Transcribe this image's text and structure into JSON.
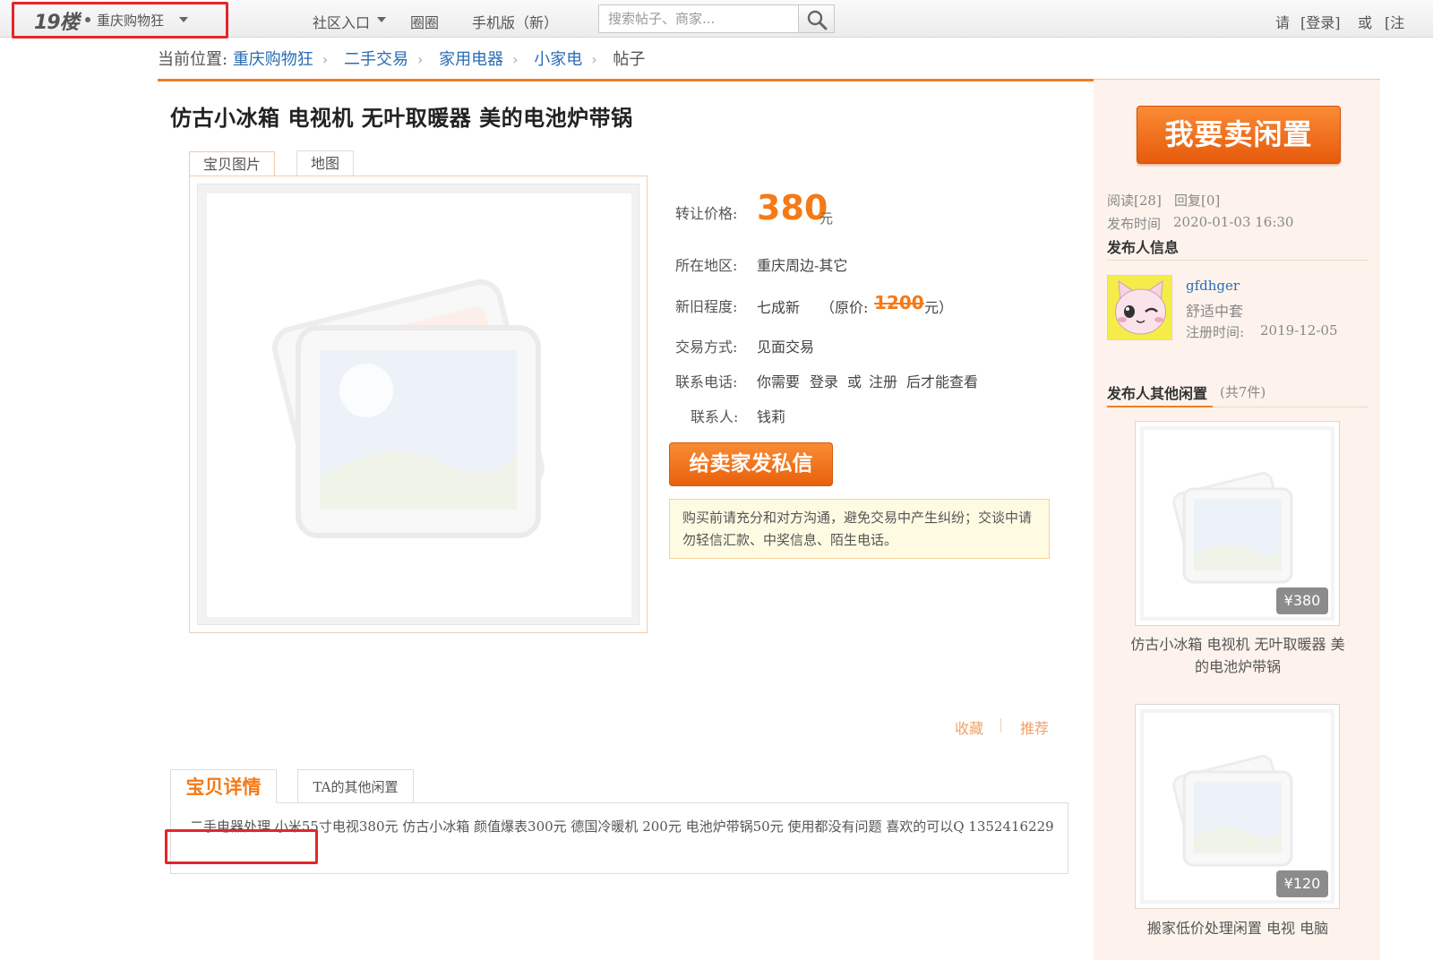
{
  "topbar": {
    "logo": "19楼",
    "community": "重庆购物狂",
    "nav": [
      "社区入口",
      "圈圈",
      "手机版（新）"
    ],
    "search_placeholder": "搜索帖子、商家...",
    "login_prefix": "请",
    "login": "[登录]",
    "or": "或",
    "register": "[注"
  },
  "breadcrumb": {
    "label": "当前位置:",
    "items": [
      "重庆购物狂",
      "二手交易",
      "家用电器",
      "小家电"
    ],
    "current": "帖子"
  },
  "post": {
    "title": "仿古小冰箱 电视机 无叶取暖器 美的电池炉带锅",
    "image_tabs": [
      "宝贝图片",
      "地图"
    ],
    "price_label": "转让价格:",
    "price": "380",
    "price_unit": "元",
    "region_label": "所在地区:",
    "region": "重庆周边-其它",
    "condition_label": "新旧程度:",
    "condition": "七成新",
    "orig_price_prefix": "（原价:",
    "orig_price": "1200",
    "orig_price_suffix": "元）",
    "trade_label": "交易方式:",
    "trade": "见面交易",
    "phone_label": "联系电话:",
    "phone_parts": [
      "你需要",
      "登录",
      "或",
      "注册",
      "后才能查看"
    ],
    "contact_label": "联系人:",
    "contact": "钱莉",
    "message_button": "给卖家发私信",
    "tip": "购买前请充分和对方沟通，避免交易中产生纠纷；交谈中请勿轻信汇款、中奖信息、陌生电话。",
    "favorite": "收藏",
    "recommend": "推荐"
  },
  "details": {
    "tab_active": "宝贝详情",
    "tab_other": "TA的其他闲置",
    "text": "二手电器处理 小米55寸电视380元 仿古小冰箱 颜值爆表300元 德国冷暖机 200元 电池炉带锅50元 使用都没有问题 喜欢的可以Q 1352416229"
  },
  "sidebar": {
    "sell_button": "我要卖闲置",
    "reads": "阅读[28]",
    "replies": "回复[0]",
    "posted_label": "发布时间",
    "posted_time": "2020-01-03 16:30",
    "publisher_heading": "发布人信息",
    "username": "gfdhger",
    "user_level": "舒适中套",
    "register_label": "注册时间:",
    "register_date": "2019-12-05",
    "other_heading": "发布人其他闲置",
    "other_count": "(共7件)",
    "items": [
      {
        "price": "¥380",
        "title": "仿古小冰箱 电视机 无叶取暖器 美的电池炉带锅"
      },
      {
        "price": "¥120",
        "title": "搬家低价处理闲置 电视 电脑"
      }
    ]
  },
  "colors": {
    "accent": "#f57a16",
    "link": "#2a6db5",
    "annotation_red": "#e5252a",
    "sidebar_bg": "#fdf3ec"
  }
}
